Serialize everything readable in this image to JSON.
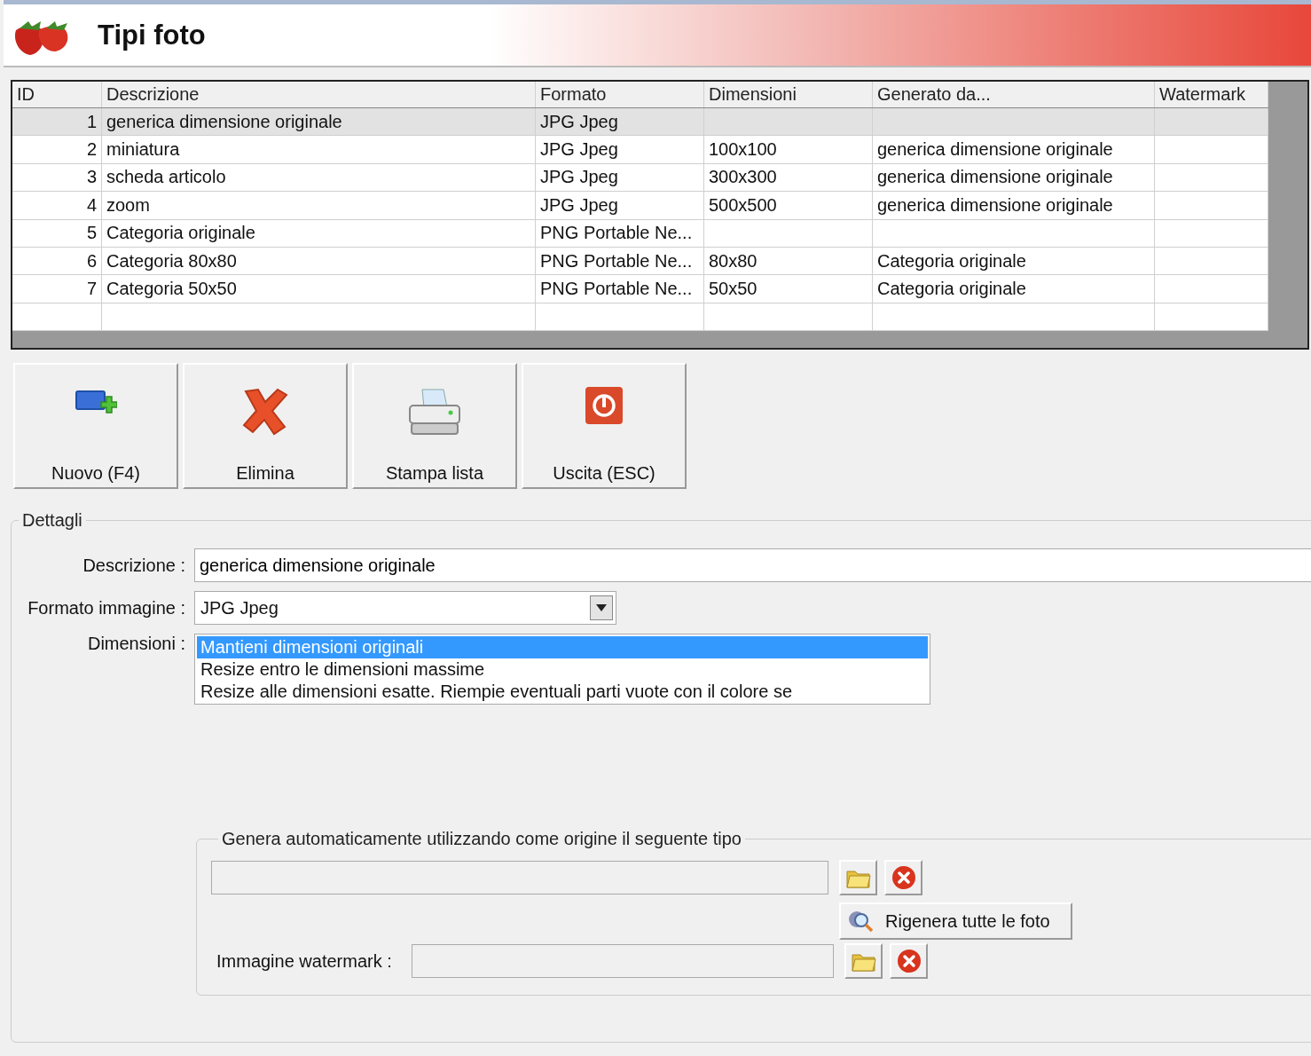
{
  "window": {
    "title": "Tipi foto"
  },
  "table": {
    "columns": [
      "ID",
      "Descrizione",
      "Formato",
      "Dimensioni",
      "Generato da...",
      "Watermark"
    ],
    "rows": [
      {
        "cells": [
          "1",
          "generica dimensione originale",
          "JPG Jpeg",
          "",
          "",
          ""
        ],
        "selected": true
      },
      {
        "cells": [
          "2",
          "miniatura",
          "JPG Jpeg",
          "100x100",
          "generica dimensione originale",
          ""
        ],
        "selected": false
      },
      {
        "cells": [
          "3",
          "scheda articolo",
          "JPG Jpeg",
          "300x300",
          "generica dimensione originale",
          ""
        ],
        "selected": false
      },
      {
        "cells": [
          "4",
          "zoom",
          "JPG Jpeg",
          "500x500",
          "generica dimensione originale",
          ""
        ],
        "selected": false
      },
      {
        "cells": [
          "5",
          "Categoria originale",
          "PNG Portable Ne...",
          "",
          "",
          ""
        ],
        "selected": false
      },
      {
        "cells": [
          "6",
          "Categoria 80x80",
          "PNG Portable Ne...",
          "80x80",
          "Categoria originale",
          ""
        ],
        "selected": false
      },
      {
        "cells": [
          "7",
          "Categoria 50x50",
          "PNG Portable Ne...",
          "50x50",
          "Categoria originale",
          ""
        ],
        "selected": false
      }
    ]
  },
  "toolbar": [
    {
      "kind": "new",
      "label": "Nuovo (F4)"
    },
    {
      "kind": "delete",
      "label": "Elimina"
    },
    {
      "kind": "print",
      "label": "Stampa lista"
    },
    {
      "kind": "exit",
      "label": "Uscita (ESC)"
    }
  ],
  "details": {
    "title": "Dettagli",
    "description": {
      "label": "Descrizione :",
      "value": "generica dimensione originale"
    },
    "format": {
      "label": "Formato immagine :",
      "value": "JPG Jpeg"
    },
    "dimensions": {
      "label": "Dimensioni :",
      "options": [
        {
          "label": "Mantieni dimensioni originali",
          "selected": true
        },
        {
          "label": "Resize entro le dimensioni massime",
          "selected": false
        },
        {
          "label": "Resize alle dimensioni esatte. Riempie eventuali parti vuote con il colore se",
          "selected": false
        }
      ]
    },
    "generate": {
      "title": "Genera automaticamente utilizzando come origine il seguente tipo",
      "regenerate_button": "Rigenera tutte le foto",
      "watermark_label": "Immagine watermark :"
    }
  }
}
